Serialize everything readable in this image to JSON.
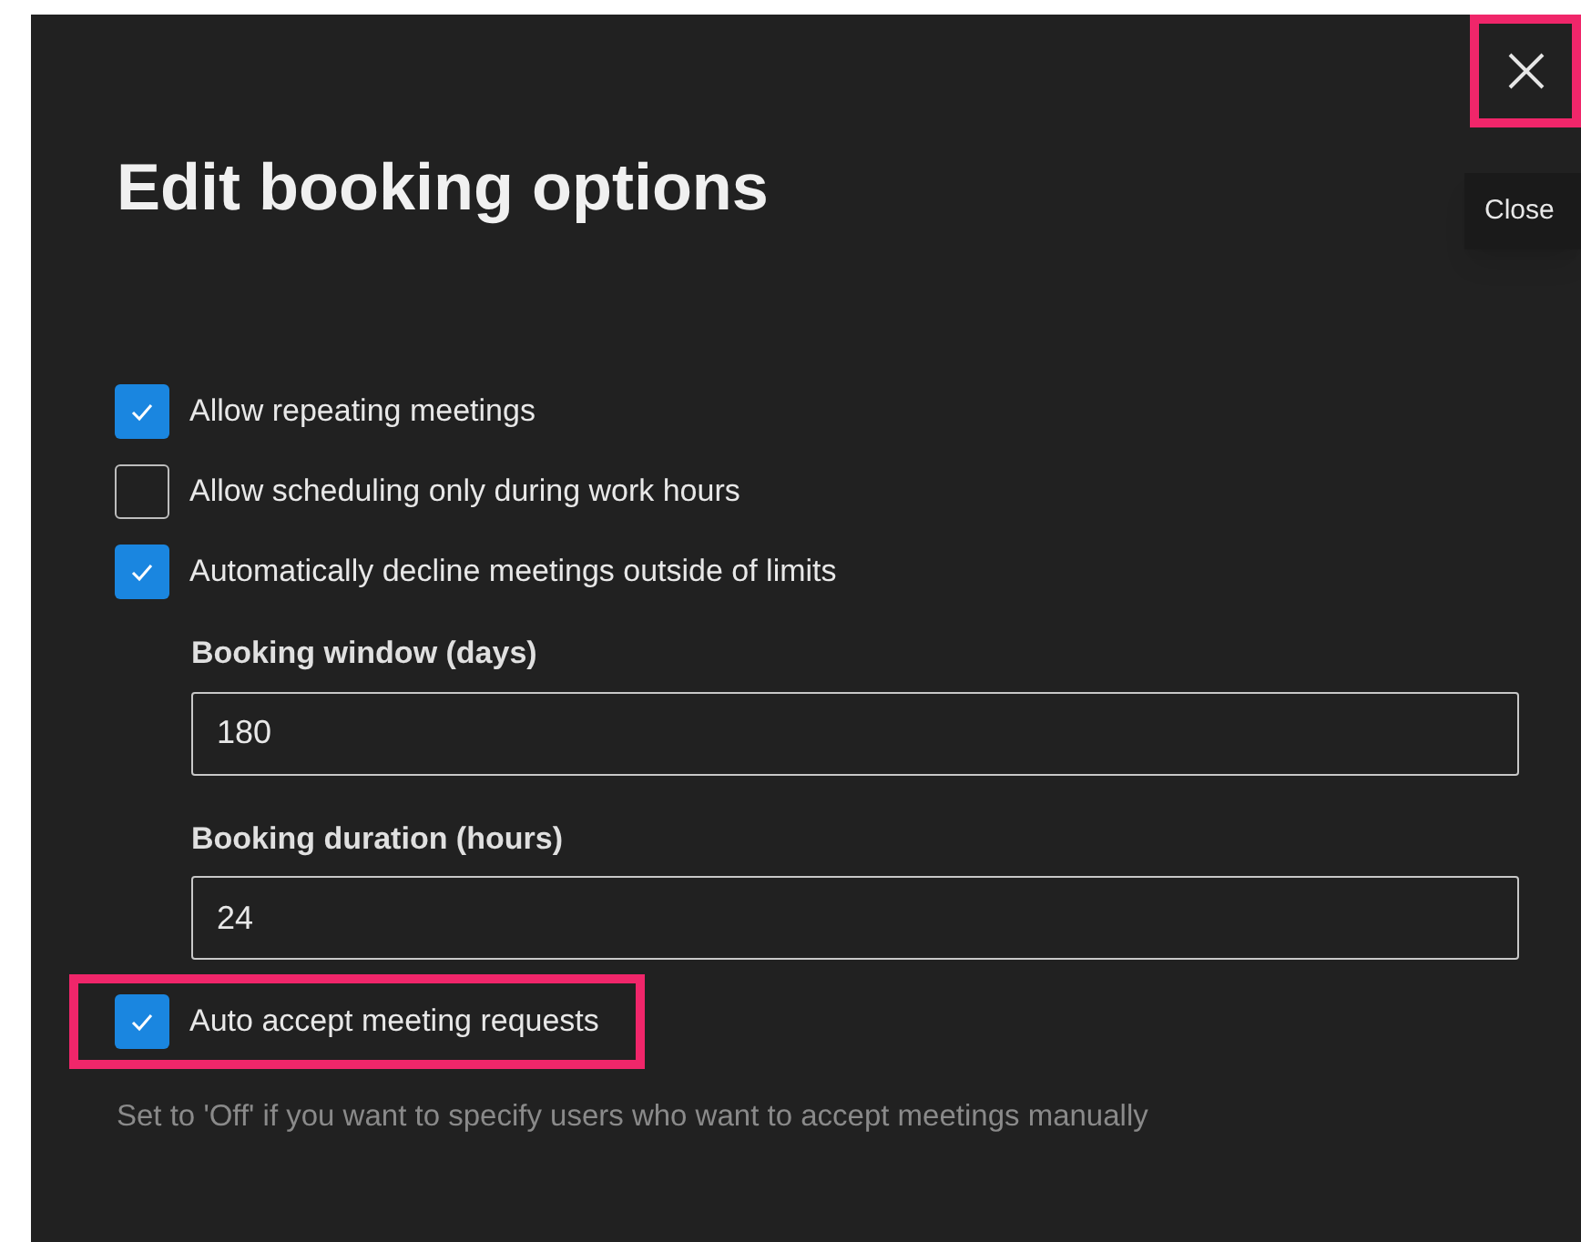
{
  "dialog": {
    "title": "Edit booking options",
    "close_button": {
      "tooltip": "Close",
      "highlighted": true
    },
    "options": [
      {
        "kind": "checkbox",
        "label": "Allow repeating meetings",
        "checked": true,
        "highlighted": false
      },
      {
        "kind": "checkbox",
        "label": "Allow scheduling only during work hours",
        "checked": false,
        "highlighted": false
      },
      {
        "kind": "checkbox",
        "label": "Automatically decline meetings outside of limits",
        "checked": true,
        "highlighted": false
      },
      {
        "kind": "field",
        "label": "Booking window (days)",
        "value": "180"
      },
      {
        "kind": "field",
        "label": "Booking duration (hours)",
        "value": "24"
      },
      {
        "kind": "checkbox",
        "label": "Auto accept meeting requests",
        "checked": true,
        "highlighted": true
      },
      {
        "kind": "hint",
        "text": "Set to 'Off' if you want to specify users who want to accept meetings manually"
      }
    ]
  }
}
